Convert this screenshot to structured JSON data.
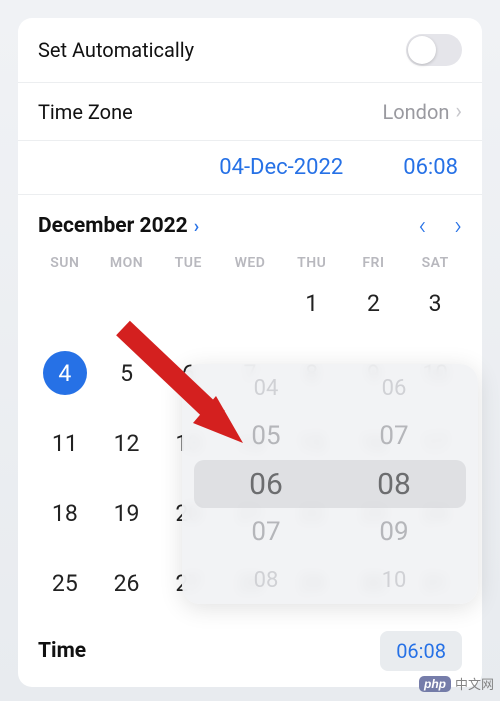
{
  "rows": {
    "set_auto_label": "Set Automatically",
    "timezone_label": "Time Zone",
    "timezone_value": "London"
  },
  "selected": {
    "date": "04-Dec-2022",
    "time": "06:08"
  },
  "calendar": {
    "month_label": "December 2022",
    "weekdays": [
      "SUN",
      "MON",
      "TUE",
      "WED",
      "THU",
      "FRI",
      "SAT"
    ],
    "leading_blanks": 4,
    "days": [
      1,
      2,
      3,
      4,
      5,
      6,
      7,
      8,
      9,
      10,
      11,
      12,
      13,
      14,
      15,
      16,
      17,
      18,
      19,
      20,
      21,
      22,
      23,
      24,
      25,
      26,
      27,
      28,
      29,
      30,
      31
    ],
    "selected_day": 4
  },
  "time_row": {
    "label": "Time",
    "value": "06:08"
  },
  "time_picker": {
    "hours": [
      "04",
      "05",
      "06",
      "07",
      "08"
    ],
    "minutes": [
      "06",
      "07",
      "08",
      "09",
      "10"
    ],
    "selected_hour": "06",
    "selected_minute": "08"
  },
  "watermark": {
    "brand": "php",
    "text": "中文网"
  }
}
